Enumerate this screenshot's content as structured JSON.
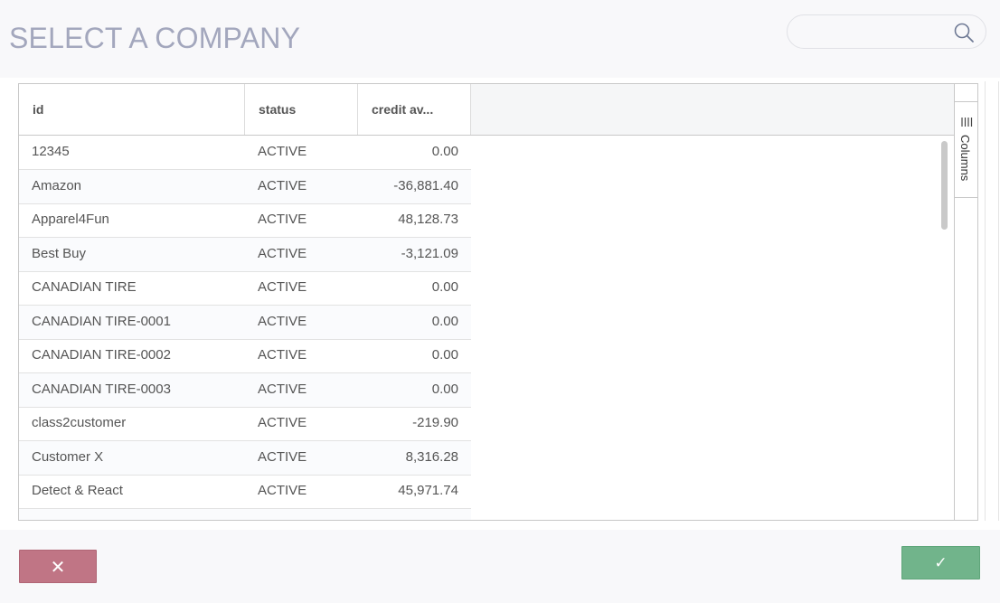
{
  "header": {
    "title": "SELECT A COMPANY",
    "search": {
      "value": "",
      "placeholder": ""
    }
  },
  "grid": {
    "columns": [
      {
        "label": "id"
      },
      {
        "label": "status"
      },
      {
        "label": "credit av..."
      }
    ],
    "rows": [
      {
        "id": "12345",
        "status": "ACTIVE",
        "credit": "0.00"
      },
      {
        "id": "Amazon",
        "status": "ACTIVE",
        "credit": "-36,881.40"
      },
      {
        "id": "Apparel4Fun",
        "status": "ACTIVE",
        "credit": "48,128.73"
      },
      {
        "id": "Best Buy",
        "status": "ACTIVE",
        "credit": "-3,121.09"
      },
      {
        "id": "CANADIAN TIRE",
        "status": "ACTIVE",
        "credit": "0.00"
      },
      {
        "id": "CANADIAN TIRE-0001",
        "status": "ACTIVE",
        "credit": "0.00"
      },
      {
        "id": "CANADIAN TIRE-0002",
        "status": "ACTIVE",
        "credit": "0.00"
      },
      {
        "id": "CANADIAN TIRE-0003",
        "status": "ACTIVE",
        "credit": "0.00"
      },
      {
        "id": "class2customer",
        "status": "ACTIVE",
        "credit": "-219.90"
      },
      {
        "id": "Customer X",
        "status": "ACTIVE",
        "credit": "8,316.28"
      },
      {
        "id": "Detect & React",
        "status": "ACTIVE",
        "credit": "45,971.74"
      },
      {
        "id": "",
        "status": "",
        "credit": ""
      }
    ],
    "side_panel": {
      "columns_label": "Columns"
    }
  },
  "footer": {
    "cancel_label": "✕",
    "confirm_label": "✓"
  },
  "colors": {
    "title": "#a3a7bd",
    "cancel": "#c07585",
    "confirm": "#71b48b"
  },
  "icons": {
    "search": "search-icon",
    "columns": "columns-icon",
    "cancel": "close-icon",
    "confirm": "check-icon"
  }
}
